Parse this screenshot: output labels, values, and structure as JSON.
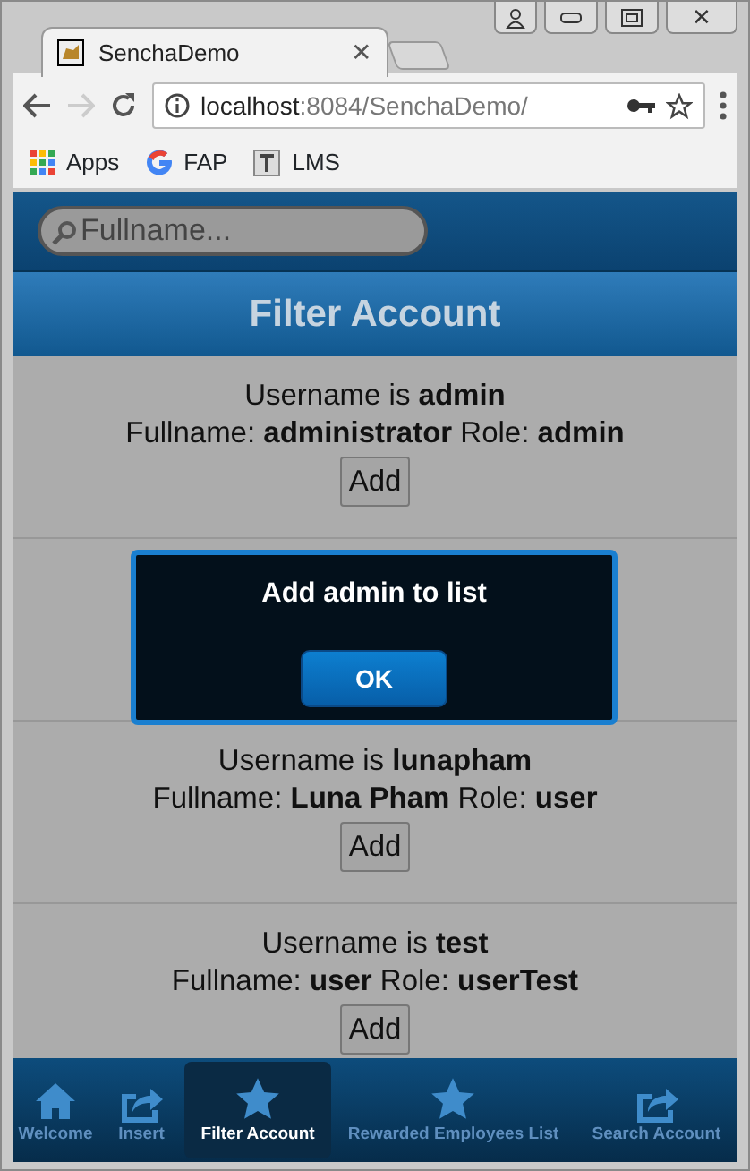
{
  "browser": {
    "tab_title": "SenchaDemo",
    "url_host": "localhost",
    "url_rest": ":8084/SenchaDemo/",
    "bookmarks": [
      "Apps",
      "FAP",
      "LMS"
    ],
    "tab_close": "✕",
    "window_close": "✕"
  },
  "search": {
    "placeholder": "Fullname..."
  },
  "title": "Filter Account",
  "accounts": [
    {
      "line1": "Username is **admin**",
      "line2": "Fullname: **administrator** Role: **admin**",
      "add": "Add"
    },
    {
      "line1": "Username is **lunapham**",
      "line2": "Fullname: **Luna Pham** Role: **user**",
      "add": "Add"
    },
    {
      "line1": "Username is **test**",
      "line2": "Fullname: **user** Role: **userTest**",
      "add": "Add"
    }
  ],
  "dialog": {
    "message": "Add admin to list",
    "button": "OK"
  },
  "tabbar": [
    {
      "label": "Welcome",
      "selected": false
    },
    {
      "label": "Insert",
      "selected": false
    },
    {
      "label": "Filter Account",
      "selected": true
    },
    {
      "label": "Rewarded Employees List",
      "selected": false
    },
    {
      "label": "Search Account",
      "selected": false
    }
  ]
}
